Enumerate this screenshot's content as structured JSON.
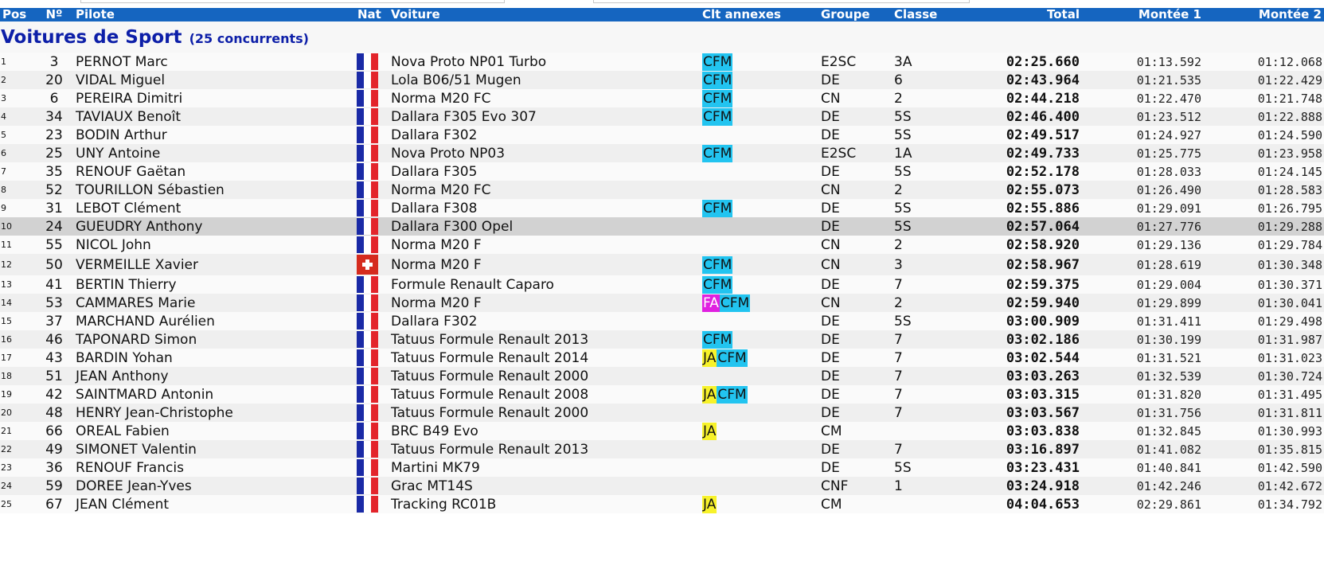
{
  "columns": {
    "pos": "Pos",
    "no": "Nº",
    "pilote": "Pilote",
    "nat": "Nat",
    "voiture": "Voiture",
    "clt": "Clt annexes",
    "groupe": "Groupe",
    "classe": "Classe",
    "total": "Total",
    "m1": "Montée 1",
    "m2": "Montée 2"
  },
  "category": {
    "title": "Voitures de Sport",
    "count": "(25 concurrents)"
  },
  "badge_colors": {
    "CFM": "#22c4f0",
    "JA": "#f7f22a",
    "FA": "#e020e0"
  },
  "rows": [
    {
      "pos": "1",
      "no": "3",
      "pilote": "PERNOT Marc",
      "nat": "fr",
      "voiture": "Nova Proto NP01 Turbo",
      "badges": [
        "CFM"
      ],
      "groupe": "E2SC",
      "classe": "3A",
      "total": "02:25.660",
      "m1": "01:13.592",
      "m2": "01:12.068"
    },
    {
      "pos": "2",
      "no": "20",
      "pilote": "VIDAL Miguel",
      "nat": "fr",
      "voiture": "Lola B06/51 Mugen",
      "badges": [
        "CFM"
      ],
      "groupe": "DE",
      "classe": "6",
      "total": "02:43.964",
      "m1": "01:21.535",
      "m2": "01:22.429"
    },
    {
      "pos": "3",
      "no": "6",
      "pilote": "PEREIRA Dimitri",
      "nat": "fr",
      "voiture": "Norma M20 FC",
      "badges": [
        "CFM"
      ],
      "groupe": "CN",
      "classe": "2",
      "total": "02:44.218",
      "m1": "01:22.470",
      "m2": "01:21.748"
    },
    {
      "pos": "4",
      "no": "34",
      "pilote": "TAVIAUX Benoît",
      "nat": "fr",
      "voiture": "Dallara F305 Evo 307",
      "badges": [
        "CFM"
      ],
      "groupe": "DE",
      "classe": "5S",
      "total": "02:46.400",
      "m1": "01:23.512",
      "m2": "01:22.888"
    },
    {
      "pos": "5",
      "no": "23",
      "pilote": "BODIN Arthur",
      "nat": "fr",
      "voiture": "Dallara F302",
      "badges": [],
      "groupe": "DE",
      "classe": "5S",
      "total": "02:49.517",
      "m1": "01:24.927",
      "m2": "01:24.590"
    },
    {
      "pos": "6",
      "no": "25",
      "pilote": "UNY Antoine",
      "nat": "fr",
      "voiture": "Nova Proto NP03",
      "badges": [
        "CFM"
      ],
      "groupe": "E2SC",
      "classe": "1A",
      "total": "02:49.733",
      "m1": "01:25.775",
      "m2": "01:23.958"
    },
    {
      "pos": "7",
      "no": "35",
      "pilote": "RENOUF Gaëtan",
      "nat": "fr",
      "voiture": "Dallara F305",
      "badges": [],
      "groupe": "DE",
      "classe": "5S",
      "total": "02:52.178",
      "m1": "01:28.033",
      "m2": "01:24.145"
    },
    {
      "pos": "8",
      "no": "52",
      "pilote": "TOURILLON Sébastien",
      "nat": "fr",
      "voiture": "Norma M20 FC",
      "badges": [],
      "groupe": "CN",
      "classe": "2",
      "total": "02:55.073",
      "m1": "01:26.490",
      "m2": "01:28.583"
    },
    {
      "pos": "9",
      "no": "31",
      "pilote": "LEBOT Clément",
      "nat": "fr",
      "voiture": "Dallara F308",
      "badges": [
        "CFM"
      ],
      "groupe": "DE",
      "classe": "5S",
      "total": "02:55.886",
      "m1": "01:29.091",
      "m2": "01:26.795"
    },
    {
      "pos": "10",
      "no": "24",
      "pilote": "GUEUDRY Anthony",
      "nat": "fr",
      "voiture": "Dallara F300 Opel",
      "badges": [],
      "groupe": "DE",
      "classe": "5S",
      "total": "02:57.064",
      "m1": "01:27.776",
      "m2": "01:29.288"
    },
    {
      "pos": "11",
      "no": "55",
      "pilote": "NICOL John",
      "nat": "fr",
      "voiture": "Norma M20 F",
      "badges": [],
      "groupe": "CN",
      "classe": "2",
      "total": "02:58.920",
      "m1": "01:29.136",
      "m2": "01:29.784"
    },
    {
      "pos": "12",
      "no": "50",
      "pilote": "VERMEILLE Xavier",
      "nat": "ch",
      "voiture": "Norma M20 F",
      "badges": [
        "CFM"
      ],
      "groupe": "CN",
      "classe": "3",
      "total": "02:58.967",
      "m1": "01:28.619",
      "m2": "01:30.348"
    },
    {
      "pos": "13",
      "no": "41",
      "pilote": "BERTIN Thierry",
      "nat": "fr",
      "voiture": "Formule Renault Caparo",
      "badges": [
        "CFM"
      ],
      "groupe": "DE",
      "classe": "7",
      "total": "02:59.375",
      "m1": "01:29.004",
      "m2": "01:30.371"
    },
    {
      "pos": "14",
      "no": "53",
      "pilote": "CAMMARES Marie",
      "nat": "fr",
      "voiture": "Norma M20 F",
      "badges": [
        "FA",
        "CFM"
      ],
      "groupe": "CN",
      "classe": "2",
      "total": "02:59.940",
      "m1": "01:29.899",
      "m2": "01:30.041"
    },
    {
      "pos": "15",
      "no": "37",
      "pilote": "MARCHAND Aurélien",
      "nat": "fr",
      "voiture": "Dallara F302",
      "badges": [],
      "groupe": "DE",
      "classe": "5S",
      "total": "03:00.909",
      "m1": "01:31.411",
      "m2": "01:29.498"
    },
    {
      "pos": "16",
      "no": "46",
      "pilote": "TAPONARD Simon",
      "nat": "fr",
      "voiture": "Tatuus Formule Renault 2013",
      "badges": [
        "CFM"
      ],
      "groupe": "DE",
      "classe": "7",
      "total": "03:02.186",
      "m1": "01:30.199",
      "m2": "01:31.987"
    },
    {
      "pos": "17",
      "no": "43",
      "pilote": "BARDIN Yohan",
      "nat": "fr",
      "voiture": "Tatuus Formule Renault 2014",
      "badges": [
        "JA",
        "CFM"
      ],
      "groupe": "DE",
      "classe": "7",
      "total": "03:02.544",
      "m1": "01:31.521",
      "m2": "01:31.023"
    },
    {
      "pos": "18",
      "no": "51",
      "pilote": "JEAN Anthony",
      "nat": "fr",
      "voiture": "Tatuus Formule Renault 2000",
      "badges": [],
      "groupe": "DE",
      "classe": "7",
      "total": "03:03.263",
      "m1": "01:32.539",
      "m2": "01:30.724"
    },
    {
      "pos": "19",
      "no": "42",
      "pilote": "SAINTMARD Antonin",
      "nat": "fr",
      "voiture": "Tatuus Formule Renault 2008",
      "badges": [
        "JA",
        "CFM"
      ],
      "groupe": "DE",
      "classe": "7",
      "total": "03:03.315",
      "m1": "01:31.820",
      "m2": "01:31.495"
    },
    {
      "pos": "20",
      "no": "48",
      "pilote": "HENRY Jean-Christophe",
      "nat": "fr",
      "voiture": "Tatuus Formule Renault 2000",
      "badges": [],
      "groupe": "DE",
      "classe": "7",
      "total": "03:03.567",
      "m1": "01:31.756",
      "m2": "01:31.811"
    },
    {
      "pos": "21",
      "no": "66",
      "pilote": "OREAL Fabien",
      "nat": "fr",
      "voiture": "BRC B49 Evo",
      "badges": [
        "JA"
      ],
      "groupe": "CM",
      "classe": "",
      "total": "03:03.838",
      "m1": "01:32.845",
      "m2": "01:30.993"
    },
    {
      "pos": "22",
      "no": "49",
      "pilote": "SIMONET Valentin",
      "nat": "fr",
      "voiture": "Tatuus Formule Renault 2013",
      "badges": [],
      "groupe": "DE",
      "classe": "7",
      "total": "03:16.897",
      "m1": "01:41.082",
      "m2": "01:35.815"
    },
    {
      "pos": "23",
      "no": "36",
      "pilote": "RENOUF Francis",
      "nat": "fr",
      "voiture": "Martini MK79",
      "badges": [],
      "groupe": "DE",
      "classe": "5S",
      "total": "03:23.431",
      "m1": "01:40.841",
      "m2": "01:42.590"
    },
    {
      "pos": "24",
      "no": "59",
      "pilote": "DOREE Jean-Yves",
      "nat": "fr",
      "voiture": "Grac MT14S",
      "badges": [],
      "groupe": "CNF",
      "classe": "1",
      "total": "03:24.918",
      "m1": "01:42.246",
      "m2": "01:42.672"
    },
    {
      "pos": "25",
      "no": "67",
      "pilote": "JEAN Clément",
      "nat": "fr",
      "voiture": "Tracking RC01B",
      "badges": [
        "JA"
      ],
      "groupe": "CM",
      "classe": "",
      "total": "04:04.653",
      "m1": "02:29.861",
      "m2": "01:34.792"
    }
  ]
}
